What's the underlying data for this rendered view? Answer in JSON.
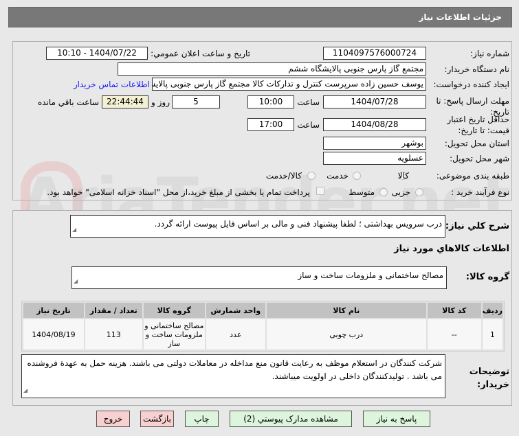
{
  "header": {
    "title": "جزئیات اطلاعات نیاز"
  },
  "watermark": "AriaTender.net",
  "form": {
    "need_number_label": "شماره نیاز:",
    "need_number": "1104097576000724",
    "announce_label": "تاریخ و ساعت اعلان عمومي:",
    "announce_value": "1404/07/22 - 10:10",
    "buyer_label": "نام دستگاه خريدار:",
    "buyer_value": "مجتمع گاز پارس جنوبی  پالایشگاه ششم",
    "creator_label": "ایجاد کننده درخواست:",
    "creator_value": "یوسف حسین زاده سرپرست کنترل و تداركات کالا مجتمع گاز پارس جنوبی  پالایشگاه ششم",
    "contact_link": "اطلاعات تماس خریدار",
    "deadline_label": "مهلت ارسال پاسخ: تا تاریخ:",
    "deadline_date": "1404/07/28",
    "time_label": "ساعت",
    "deadline_time": "10:00",
    "days": "5",
    "days_label": "روز و",
    "remaining": "22:44:44",
    "remaining_label": "ساعت باقي مانده",
    "validity_label": "حداقل تاریخ اعتبار قیمت: تا تاریخ:",
    "validity_date": "1404/08/28",
    "validity_time": "17:00",
    "province_label": "استان محل تحویل:",
    "province": "بوشهر",
    "city_label": "شهر محل تحویل:",
    "city": "عسلویه",
    "category_label": "طبقه بندی موضوعی:",
    "category_options": [
      "کالا",
      "خدمت",
      "کالا/خدمت"
    ],
    "category_selected": "کالا",
    "process_label": "نوع فرآیند خرید :",
    "process_options": [
      "جزیی",
      "متوسط"
    ],
    "payment_note": "پرداخت تمام یا بخشی از مبلغ خرید،از محل \"اسناد خزانه اسلامی\" خواهد بود."
  },
  "details": {
    "desc_label": "شرح کلي نياز:",
    "desc": "درب سرویس بهداشتی ؛ لطفا پیشنهاد فنی و مالی بر اساس فایل پیوست ارائه گردد.",
    "goods_title": "اطلاعات کالاهاي مورد نياز",
    "group_label": "گروه کالا:",
    "group": "مصالح ساختمانی و ملزومات ساخت و ساز",
    "table": {
      "headers": [
        "ردیف",
        "کد کالا",
        "نام کالا",
        "واحد شمارش",
        "گروه کالا",
        "تعداد / مقدار",
        "تاریخ نیاز"
      ],
      "rows": [
        [
          "1",
          "--",
          "درب چوبی",
          "عدد",
          "مصالح ساختمانی و ملزومات ساخت و ساز",
          "113",
          "1404/08/19"
        ]
      ]
    },
    "notes_label": "توضیحات خریدار:",
    "notes": "شرکت کنندگان در استعلام موظف به رعایت قانون منع مداخله در معاملات دولتی می باشند. هزینه حمل به عهدة فروشنده می باشد . تولیدکنندگان داخلی در اولویت میباشند."
  },
  "buttons": {
    "reply": "پاسخ به نياز",
    "attachments": "مشاهده مدارک پيوستي (2)",
    "print": "چاپ",
    "back": "بازگشت",
    "exit": "خروج"
  }
}
